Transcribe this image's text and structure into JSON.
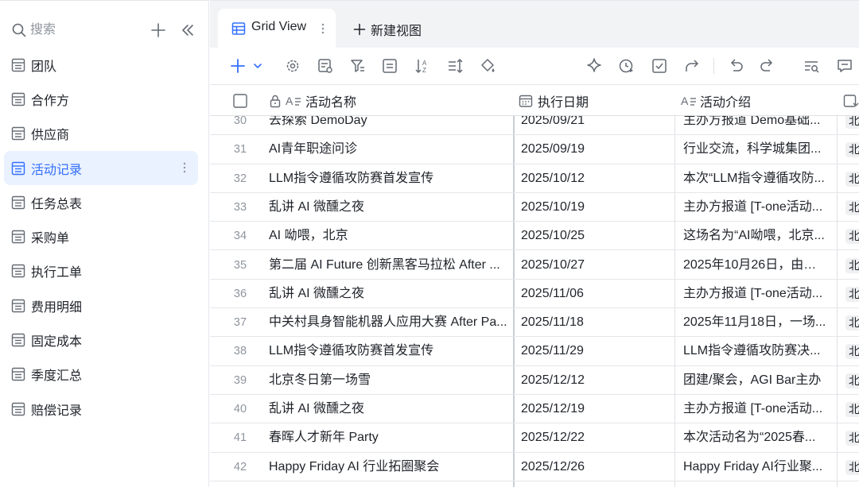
{
  "sidebar": {
    "search_placeholder": "搜索",
    "items": [
      {
        "label": "团队",
        "icon": "table-icon",
        "active": false
      },
      {
        "label": "合作方",
        "icon": "table-icon",
        "active": false
      },
      {
        "label": "供应商",
        "icon": "table-icon",
        "active": false
      },
      {
        "label": "活动记录",
        "icon": "table-icon",
        "active": true
      },
      {
        "label": "任务总表",
        "icon": "table-icon",
        "active": false
      },
      {
        "label": "采购单",
        "icon": "table-icon",
        "active": false
      },
      {
        "label": "执行工单",
        "icon": "table-icon",
        "active": false
      },
      {
        "label": "费用明细",
        "icon": "table-icon",
        "active": false
      },
      {
        "label": "固定成本",
        "icon": "table-icon",
        "active": false
      },
      {
        "label": "季度汇总",
        "icon": "table-icon",
        "active": false
      },
      {
        "label": "赔偿记录",
        "icon": "table-icon",
        "active": false
      }
    ]
  },
  "views": {
    "active_tab": "Grid View",
    "new_view": "新建视图"
  },
  "grid": {
    "columns": {
      "name": "活动名称",
      "date": "执行日期",
      "intro": "活动介绍"
    },
    "rows": [
      {
        "num": "30",
        "name": "去探索 DemoDay",
        "date": "2025/09/21",
        "intro": "主办方报道 Demo基础...",
        "tag": "北"
      },
      {
        "num": "31",
        "name": "AI青年职途问诊",
        "date": "2025/09/19",
        "intro": "行业交流，科学城集团...",
        "tag": "北"
      },
      {
        "num": "32",
        "name": "LLM指令遵循攻防赛首发宣传",
        "date": "2025/10/12",
        "intro": "本次“LLM指令遵循攻防...",
        "tag": "北"
      },
      {
        "num": "33",
        "name": "乱讲 AI 微醺之夜",
        "date": "2025/10/19",
        "intro": "主办方报道 [T-one活动...",
        "tag": "北"
      },
      {
        "num": "34",
        "name": "AI 呦喂，北京",
        "date": "2025/10/25",
        "intro": "这场名为“AI呦喂，北京...",
        "tag": "北"
      },
      {
        "num": "35",
        "name": "第二届 AI Future 创新黑客马拉松 After ...",
        "date": "2025/10/27",
        "intro": "2025年10月26日，由北...",
        "tag": "北"
      },
      {
        "num": "36",
        "name": "乱讲 AI 微醺之夜",
        "date": "2025/11/06",
        "intro": "主办方报道 [T-one活动...",
        "tag": "北"
      },
      {
        "num": "37",
        "name": "中关村具身智能机器人应用大赛 After Pa...",
        "date": "2025/11/18",
        "intro": "2025年11月18日，一场...",
        "tag": "北"
      },
      {
        "num": "38",
        "name": "LLM指令遵循攻防赛首发宣传",
        "date": "2025/11/29",
        "intro": "LLM指令遵循攻防赛决...",
        "tag": "北"
      },
      {
        "num": "39",
        "name": "北京冬日第一场雪",
        "date": "2025/12/12",
        "intro": "团建/聚会，AGI Bar主办",
        "tag": "北"
      },
      {
        "num": "40",
        "name": "乱讲 AI 微醺之夜",
        "date": "2025/12/19",
        "intro": "主办方报道 [T-one活动...",
        "tag": "北"
      },
      {
        "num": "41",
        "name": "春晖人才新年 Party",
        "date": "2025/12/22",
        "intro": "本次活动名为“2025春...",
        "tag": "北"
      },
      {
        "num": "42",
        "name": "Happy Friday AI 行业拓圈聚会",
        "date": "2025/12/26",
        "intro": "Happy Friday AI行业聚...",
        "tag": "北"
      }
    ]
  }
}
